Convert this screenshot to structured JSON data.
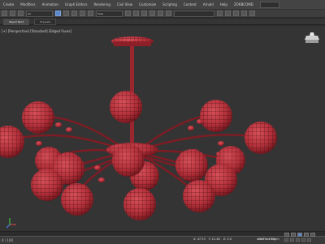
{
  "menus": [
    "Create",
    "Modifiers",
    "Animation",
    "Graph Editors",
    "Rendering",
    "Civil View",
    "Customize",
    "Scripting",
    "Content",
    "Arnold",
    "Help",
    "ZORBCOMD"
  ],
  "toolbar": {
    "filter_label": "All",
    "view_label": "View"
  },
  "tabs": [
    "Object Paint",
    "Populate"
  ],
  "viewport": {
    "label": "[+] [Perspective] [Standard] [Edged Faces]"
  },
  "status": {
    "left_text": "0 / 100",
    "x": "X: 47.53",
    "y": "Y: 12.48",
    "z": "Z: 0.0",
    "grid": "Grid = 10.0cm",
    "addtime": "Add Time Tag"
  },
  "colors": {
    "sphere": "#b3303a",
    "wire": "#3a0d10",
    "viewport_bg": "#343434"
  },
  "icons": [
    "select-icon",
    "move-icon",
    "rotate-icon",
    "scale-icon",
    "snap-icon",
    "render-icon",
    "viewcube-icon",
    "play-icon",
    "zoom-icon",
    "orbit-icon",
    "pan-icon"
  ]
}
